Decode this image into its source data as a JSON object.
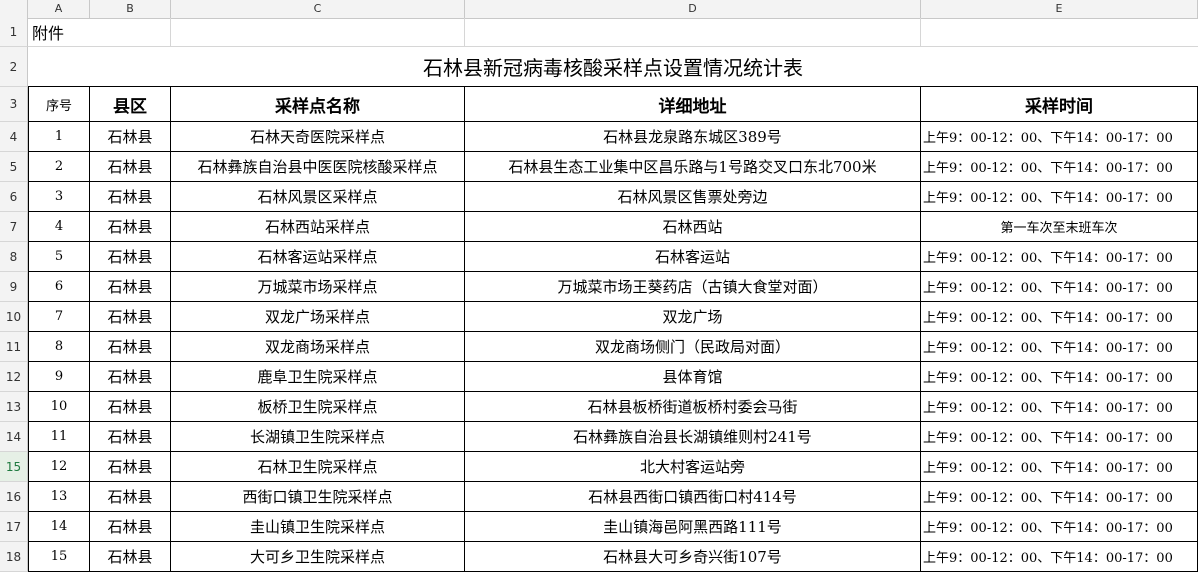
{
  "columns": [
    "A",
    "B",
    "C",
    "D",
    "E"
  ],
  "row_numbers": [
    "1",
    "2",
    "3",
    "4",
    "5",
    "6",
    "7",
    "8",
    "9",
    "10",
    "11",
    "12",
    "13",
    "14",
    "15",
    "16",
    "17",
    "18"
  ],
  "appendix_label": "附件",
  "title": "石林县新冠病毒核酸采样点设置情况统计表",
  "headers": {
    "seq": "序号",
    "county": "县区",
    "site": "采样点名称",
    "address": "详细地址",
    "time": "采样时间"
  },
  "rows": [
    {
      "seq": "1",
      "county": "石林县",
      "site": "石林天奇医院采样点",
      "address": "石林县龙泉路东城区389号",
      "time": "上午9：00-12：00、下午14：00-17：00"
    },
    {
      "seq": "2",
      "county": "石林县",
      "site": "石林彝族自治县中医医院核酸采样点",
      "address": "石林县生态工业集中区昌乐路与1号路交叉口东北700米",
      "time": "上午9：00-12：00、下午14：00-17：00"
    },
    {
      "seq": "3",
      "county": "石林县",
      "site": "石林风景区采样点",
      "address": "石林风景区售票处旁边",
      "time": "上午9：00-12：00、下午14：00-17：00"
    },
    {
      "seq": "4",
      "county": "石林县",
      "site": "石林西站采样点",
      "address": "石林西站",
      "time": "第一车次至末班车次"
    },
    {
      "seq": "5",
      "county": "石林县",
      "site": "石林客运站采样点",
      "address": "石林客运站",
      "time": "上午9：00-12：00、下午14：00-17：00"
    },
    {
      "seq": "6",
      "county": "石林县",
      "site": "万城菜市场采样点",
      "address": "万城菜市场王葵药店（古镇大食堂对面）",
      "time": "上午9：00-12：00、下午14：00-17：00"
    },
    {
      "seq": "7",
      "county": "石林县",
      "site": "双龙广场采样点",
      "address": "双龙广场",
      "time": "上午9：00-12：00、下午14：00-17：00"
    },
    {
      "seq": "8",
      "county": "石林县",
      "site": "双龙商场采样点",
      "address": "双龙商场侧门（民政局对面）",
      "time": "上午9：00-12：00、下午14：00-17：00"
    },
    {
      "seq": "9",
      "county": "石林县",
      "site": "鹿阜卫生院采样点",
      "address": "县体育馆",
      "time": "上午9：00-12：00、下午14：00-17：00"
    },
    {
      "seq": "10",
      "county": "石林县",
      "site": "板桥卫生院采样点",
      "address": "石林县板桥街道板桥村委会马街",
      "time": "上午9：00-12：00、下午14：00-17：00"
    },
    {
      "seq": "11",
      "county": "石林县",
      "site": "长湖镇卫生院采样点",
      "address": "石林彝族自治县长湖镇维则村241号",
      "time": "上午9：00-12：00、下午14：00-17：00"
    },
    {
      "seq": "12",
      "county": "石林县",
      "site": "石林卫生院采样点",
      "address": "北大村客运站旁",
      "time": "上午9：00-12：00、下午14：00-17：00"
    },
    {
      "seq": "13",
      "county": "石林县",
      "site": "西街口镇卫生院采样点",
      "address": "石林县西街口镇西街口村414号",
      "time": "上午9：00-12：00、下午14：00-17：00"
    },
    {
      "seq": "14",
      "county": "石林县",
      "site": "圭山镇卫生院采样点",
      "address": "圭山镇海邑阿黑西路111号",
      "time": "上午9：00-12：00、下午14：00-17：00"
    },
    {
      "seq": "15",
      "county": "石林县",
      "site": "大可乡卫生院采样点",
      "address": "石林县大可乡奇兴街107号",
      "time": "上午9：00-12：00、下午14：00-17：00"
    }
  ]
}
